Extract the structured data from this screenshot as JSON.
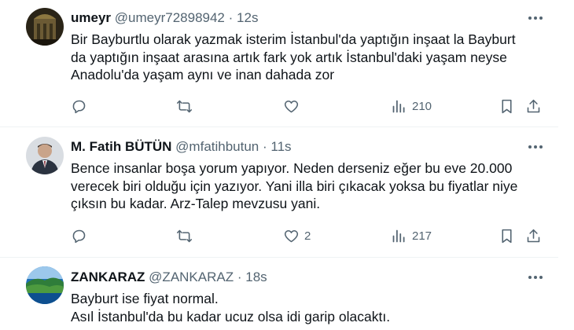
{
  "tweets": [
    {
      "name": "umeyr",
      "handle": "@umeyr72898942",
      "dot": "·",
      "time": "12s",
      "lines": [
        "Bir Bayburtlu olarak yazmak isterim İstanbul'da yaptığın inşaat la Bayburt",
        "da yaptığın inşaat arasına artık fark yok  artık İstanbul'daki yaşam neyse",
        "Anadolu'da yaşam aynı ve inan dahada zor"
      ],
      "likes": "",
      "views": "210"
    },
    {
      "name": "M. Fatih BÜTÜN",
      "handle": "@mfatihbutun",
      "dot": "·",
      "time": "11s",
      "lines": [
        "Bence insanlar boşa yorum yapıyor. Neden derseniz eğer bu eve 20.000",
        "verecek biri olduğu için yazıyor. Yani illa biri çıkacak yoksa bu fiyatlar niye",
        "çıksın bu kadar. Arz-Talep mevzusu yani."
      ],
      "likes": "2",
      "views": "217"
    },
    {
      "name": "ZANKARAZ",
      "handle": "@ZANKARAZ",
      "dot": "·",
      "time": "18s",
      "lines": [
        "Bayburt ise fiyat normal.",
        "Asıl İstanbul'da bu kadar ucuz olsa idi garip olacaktı."
      ]
    }
  ],
  "icons": {
    "reply": "reply-icon",
    "retweet": "retweet-icon",
    "like": "heart-icon",
    "views": "views-icon",
    "bookmark": "bookmark-icon",
    "share": "share-icon",
    "more": "more-icon"
  },
  "colors": {
    "text": "#0f1419",
    "secondary": "#536471",
    "divider": "#eff3f4"
  }
}
